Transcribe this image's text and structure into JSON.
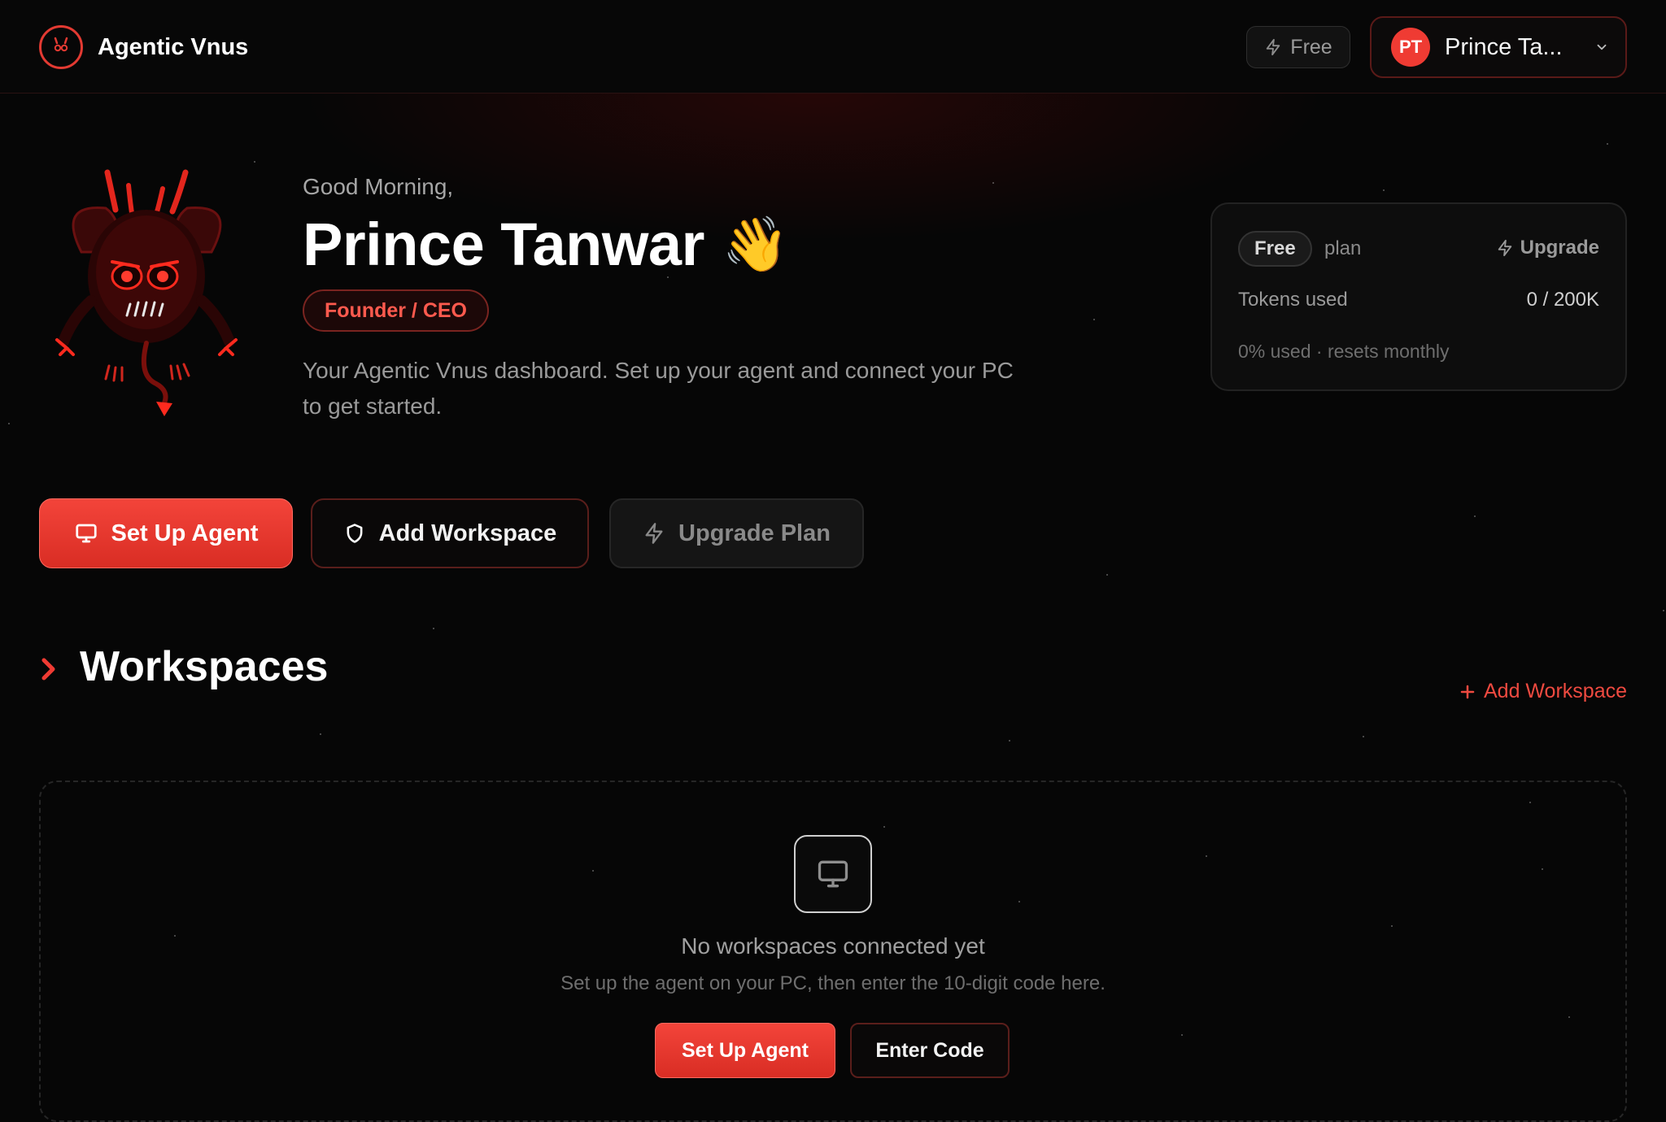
{
  "app": {
    "name": "Agentic Vnus",
    "accent_color": "#ef3b33"
  },
  "header": {
    "plan_badge": "Free",
    "user": {
      "initials": "PT",
      "display_name": "Prince Ta..."
    }
  },
  "hero": {
    "greeting": "Good Morning,",
    "name": "Prince Tanwar",
    "wave_emoji": "👋",
    "role": "Founder / CEO",
    "description": "Your Agentic Vnus dashboard. Set up your agent and connect your PC to get started."
  },
  "plan_card": {
    "plan_name": "Free",
    "plan_suffix": "plan",
    "upgrade_label": "Upgrade",
    "tokens_label": "Tokens used",
    "tokens_value": "0 / 200K",
    "usage_note": "0% used · resets monthly"
  },
  "actions": {
    "setup_agent": "Set Up Agent",
    "add_workspace": "Add Workspace",
    "upgrade_plan": "Upgrade Plan"
  },
  "workspaces": {
    "title": "Workspaces",
    "add_link": "Add Workspace",
    "empty_title": "No workspaces connected yet",
    "empty_subtitle": "Set up the agent on your PC, then enter the 10-digit code here.",
    "setup_button": "Set Up Agent",
    "enter_code_button": "Enter Code"
  },
  "icons": {
    "brand": "devil-logo-icon",
    "plan": "lightning-icon",
    "menu": "chevron-down-icon",
    "setup": "monitor-icon",
    "workspace": "shield-icon",
    "upgrade": "lightning-icon",
    "section": "chevron-right-icon",
    "add": "plus-icon",
    "empty": "monitor-icon"
  }
}
